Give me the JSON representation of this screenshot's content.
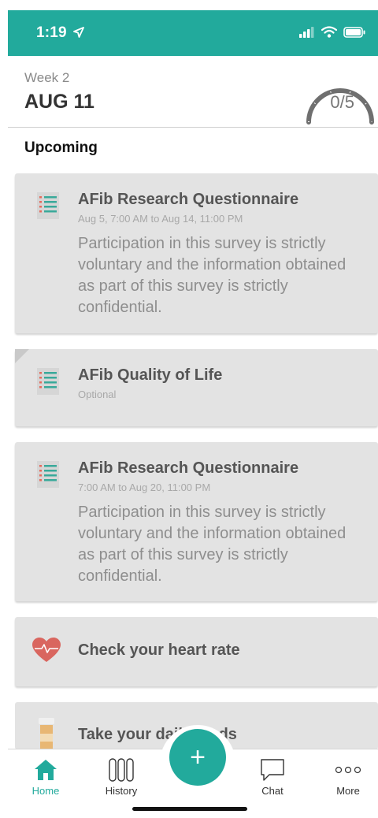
{
  "status": {
    "time": "1:19"
  },
  "header": {
    "week": "Week 2",
    "date": "AUG 11",
    "progress": "0/5",
    "progress_fraction": 0
  },
  "section_title": "Upcoming",
  "cards": [
    {
      "title": "AFib Research Questionnaire",
      "subtitle": "Aug 5, 7:00 AM to Aug 14, 11:00 PM",
      "description": "Participation in this survey is strictly voluntary and the information obtained as part of this survey is strictly confidential.",
      "icon": "checklist-icon"
    },
    {
      "title": "AFib Quality of Life",
      "subtitle": "Optional",
      "icon": "checklist-icon"
    },
    {
      "title": "AFib Research Questionnaire",
      "subtitle": "7:00 AM to Aug 20, 11:00 PM",
      "description": "Participation in this survey is strictly voluntary and the information obtained as part of this survey is strictly confidential.",
      "icon": "checklist-icon"
    },
    {
      "title": "Check your heart rate",
      "icon": "heart-rate-icon"
    },
    {
      "title": "Take your daily meds",
      "icon": "pill-bottle-icon"
    }
  ],
  "tabs": [
    {
      "label": "Home",
      "icon": "home-icon",
      "active": true
    },
    {
      "label": "History",
      "icon": "history-icon"
    },
    {
      "label": "Chat",
      "icon": "chat-icon"
    },
    {
      "label": "More",
      "icon": "more-icon"
    }
  ],
  "fab": {
    "label": "+"
  },
  "colors": {
    "accent": "#22aa9c",
    "card": "#e3e3e3",
    "gauge": "#6f6f6f",
    "heart": "#d9665f"
  }
}
